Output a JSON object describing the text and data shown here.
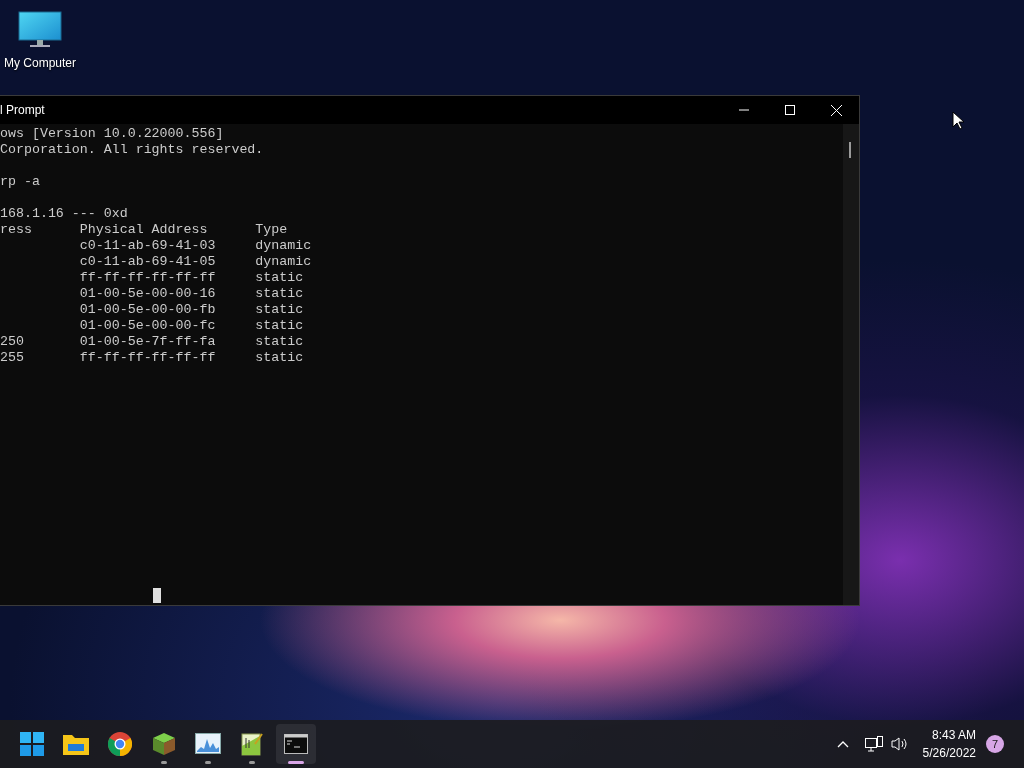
{
  "desktop_icons": [
    {
      "label": "My Computer"
    }
  ],
  "window": {
    "title": "l Prompt",
    "console_blocks": [
      [
        "ows [Version 10.0.22000.556]",
        "Corporation. All rights reserved."
      ],
      [
        "rp -a"
      ],
      [
        "168.1.16 --- 0xd",
        "ress      Physical Address      Type",
        "          c0-11-ab-69-41-03     dynamic",
        "          c0-11-ab-69-41-05     dynamic",
        "          ff-ff-ff-ff-ff-ff     static",
        "          01-00-5e-00-00-16     static",
        "          01-00-5e-00-00-fb     static",
        "          01-00-5e-00-00-fc     static",
        "250       01-00-5e-7f-ff-fa     static",
        "255       ff-ff-ff-ff-ff-ff     static"
      ]
    ]
  },
  "taskbar": {
    "apps": [
      {
        "kind": "start",
        "running": false,
        "selected": false
      },
      {
        "kind": "folder",
        "running": false,
        "selected": false
      },
      {
        "kind": "browser",
        "running": false,
        "selected": false
      },
      {
        "kind": "cube",
        "running": true,
        "selected": false
      },
      {
        "kind": "chart",
        "running": true,
        "selected": false
      },
      {
        "kind": "notepad",
        "running": true,
        "selected": false
      },
      {
        "kind": "terminal",
        "running": true,
        "selected": true
      }
    ],
    "time": "8:43 AM",
    "date": "5/26/2022",
    "notification_count": "7"
  }
}
